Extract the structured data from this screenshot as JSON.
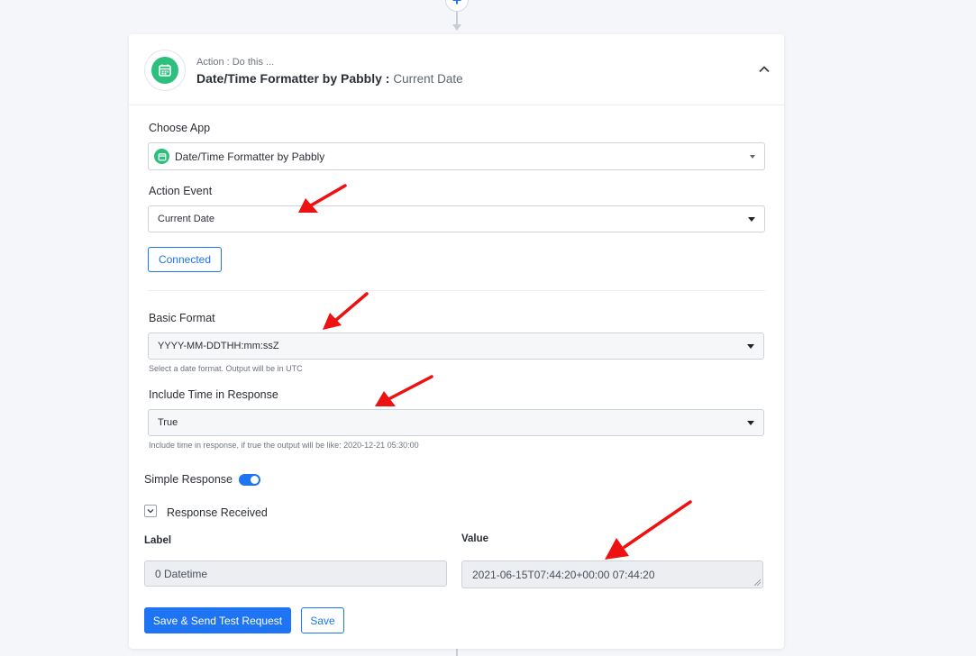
{
  "card": {
    "header": {
      "subtitle": "Action : Do this ...",
      "app_name": "Date/Time Formatter by Pabbly :",
      "event_name": "Current Date"
    },
    "choose_app": {
      "label": "Choose App",
      "value": "Date/Time Formatter by Pabbly"
    },
    "action_event": {
      "label": "Action Event",
      "value": "Current Date"
    },
    "connected_label": "Connected",
    "basic_format": {
      "label": "Basic Format",
      "value": "YYYY-MM-DDTHH:mm:ssZ",
      "hint": "Select a date format. Output will be in UTC"
    },
    "include_time": {
      "label": "Include Time in Response",
      "value": "True",
      "hint": "Include time in response, if true the output will be like: 2020-12-21 05:30:00"
    },
    "simple_response": {
      "label": "Simple Response",
      "on": true
    },
    "response_received": {
      "label": "Response Received",
      "col_label": "Label",
      "col_value": "Value",
      "row_label": "0 Datetime",
      "row_value": "2021-06-15T07:44:20+00:00 07:44:20"
    },
    "buttons": {
      "save_send": "Save & Send Test Request",
      "save": "Save"
    }
  },
  "colors": {
    "accent": "#1e74f3",
    "app_green": "#2dbf7e",
    "annotation_red": "#ee1111"
  },
  "icons": [
    "plus-icon",
    "calendar-icon",
    "chevron-up-icon",
    "chevron-down-icon",
    "dropdown-caret-icon",
    "red-arrow-annotation"
  ]
}
